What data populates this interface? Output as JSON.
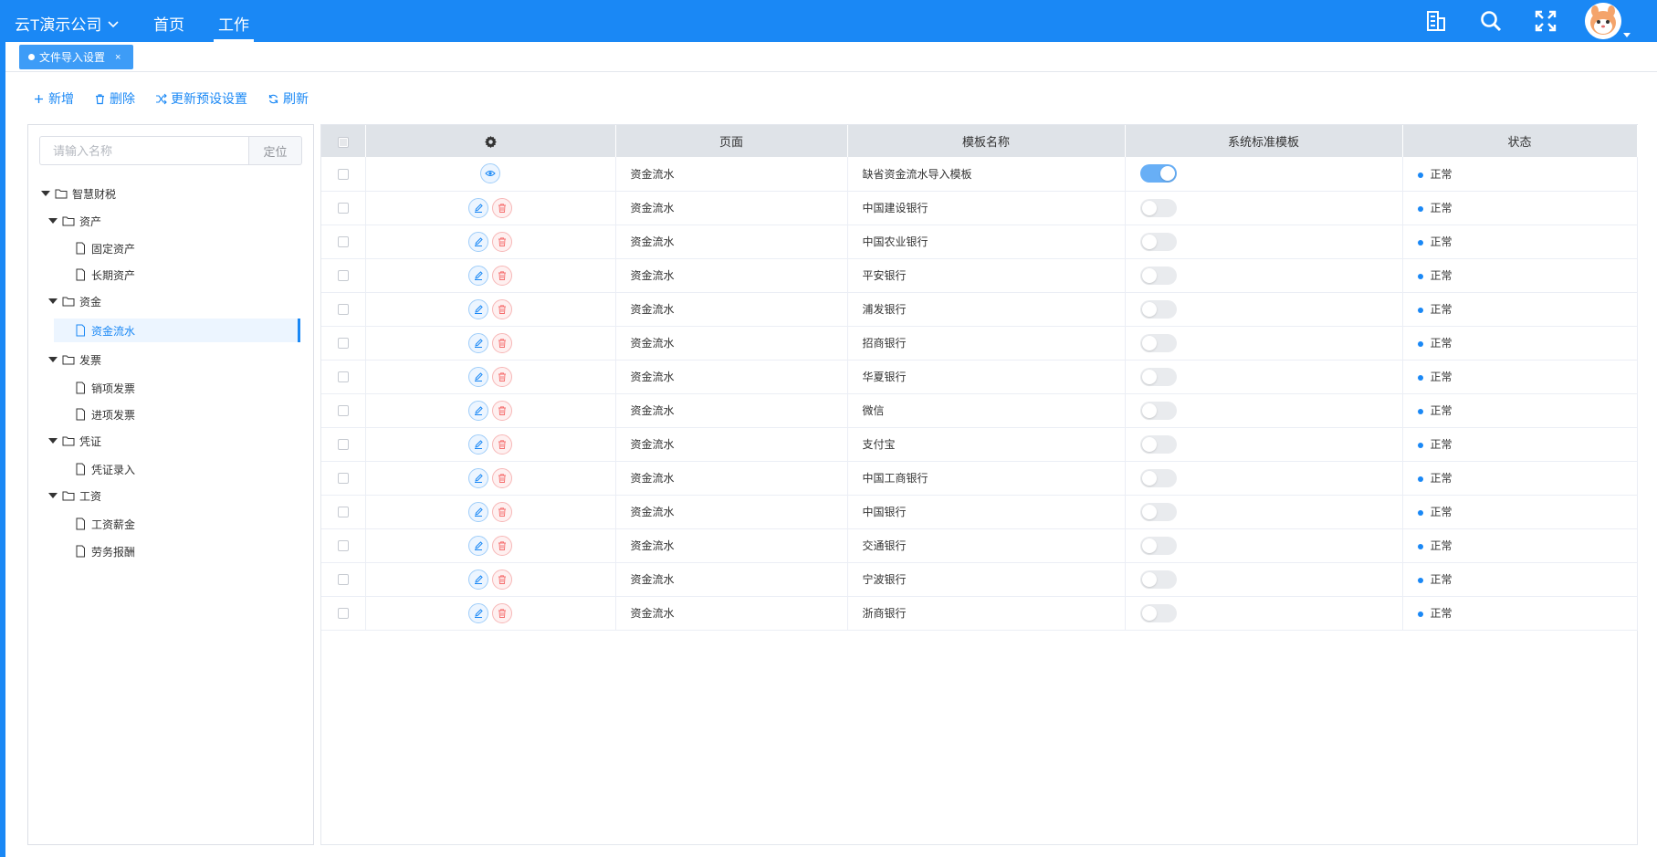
{
  "header": {
    "company": "云T演示公司",
    "nav": [
      "首页",
      "工作"
    ],
    "active_nav": 1,
    "icons": [
      "building-icon",
      "search-icon",
      "fullscreen-icon"
    ]
  },
  "tabs": [
    {
      "label": "文件导入设置",
      "close": "×"
    }
  ],
  "toolbar": {
    "add": "新增",
    "delete": "删除",
    "update": "更新预设设置",
    "refresh": "刷新"
  },
  "tree": {
    "search_placeholder": "请输入名称",
    "locate": "定位",
    "root": "智慧财税",
    "assets": "资产",
    "fixed_assets": "固定资产",
    "long_assets": "长期资产",
    "funds": "资金",
    "fund_flow": "资金流水",
    "invoice": "发票",
    "sales_invoice": "销项发票",
    "input_invoice": "进项发票",
    "voucher": "凭证",
    "voucher_entry": "凭证录入",
    "salary": "工资",
    "salary_pay": "工资薪金",
    "labor_pay": "劳务报酬"
  },
  "table": {
    "headers": {
      "page": "页面",
      "template": "模板名称",
      "standard": "系统标准模板",
      "status": "状态"
    },
    "rows": [
      {
        "page": "资金流水",
        "template": "缺省资金流水导入模板",
        "standard": true,
        "status": "正常",
        "view_only": true
      },
      {
        "page": "资金流水",
        "template": "中国建设银行",
        "standard": false,
        "status": "正常"
      },
      {
        "page": "资金流水",
        "template": "中国农业银行",
        "standard": false,
        "status": "正常"
      },
      {
        "page": "资金流水",
        "template": "平安银行",
        "standard": false,
        "status": "正常"
      },
      {
        "page": "资金流水",
        "template": "浦发银行",
        "standard": false,
        "status": "正常"
      },
      {
        "page": "资金流水",
        "template": "招商银行",
        "standard": false,
        "status": "正常"
      },
      {
        "page": "资金流水",
        "template": "华夏银行",
        "standard": false,
        "status": "正常"
      },
      {
        "page": "资金流水",
        "template": "微信",
        "standard": false,
        "status": "正常"
      },
      {
        "page": "资金流水",
        "template": "支付宝",
        "standard": false,
        "status": "正常"
      },
      {
        "page": "资金流水",
        "template": "中国工商银行",
        "standard": false,
        "status": "正常"
      },
      {
        "page": "资金流水",
        "template": "中国银行",
        "standard": false,
        "status": "正常"
      },
      {
        "page": "资金流水",
        "template": "交通银行",
        "standard": false,
        "status": "正常"
      },
      {
        "page": "资金流水",
        "template": "宁波银行",
        "standard": false,
        "status": "正常"
      },
      {
        "page": "资金流水",
        "template": "浙商银行",
        "standard": false,
        "status": "正常"
      }
    ]
  },
  "colors": {
    "primary": "#1a88f5",
    "danger": "#f56c6c",
    "header_bg": "#dfe3e8"
  }
}
